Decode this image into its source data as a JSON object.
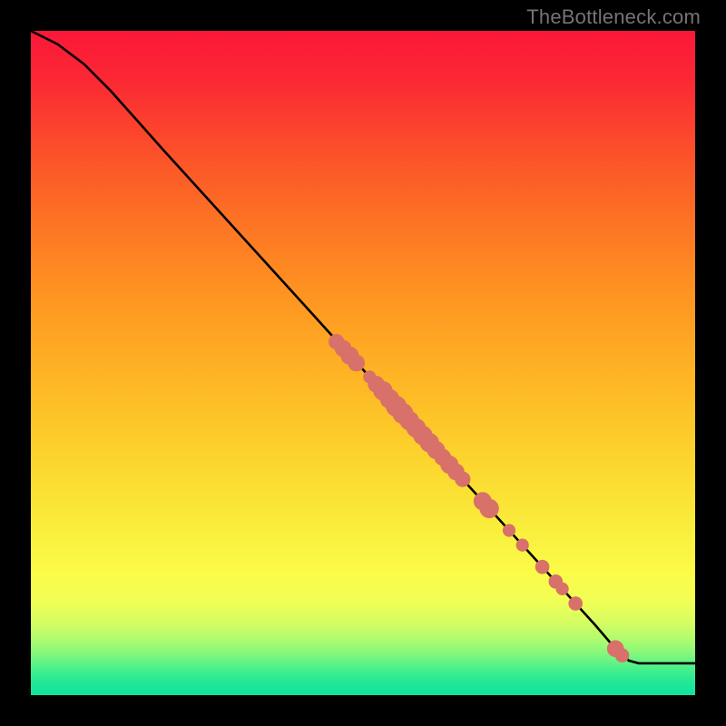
{
  "watermark": "TheBottleneck.com",
  "colors": {
    "background": "#000000",
    "curve": "#000000",
    "marker": "#d87169",
    "watermark": "#747474"
  },
  "chart_data": {
    "type": "line",
    "title": "",
    "xlabel": "",
    "ylabel": "",
    "xlim": [
      0,
      100
    ],
    "ylim": [
      0,
      100
    ],
    "curve": [
      {
        "x": 0,
        "y": 100
      },
      {
        "x": 4,
        "y": 98
      },
      {
        "x": 8,
        "y": 95
      },
      {
        "x": 12,
        "y": 91
      },
      {
        "x": 16,
        "y": 86.5
      },
      {
        "x": 20,
        "y": 82
      },
      {
        "x": 25,
        "y": 76.5
      },
      {
        "x": 30,
        "y": 71
      },
      {
        "x": 35,
        "y": 65.5
      },
      {
        "x": 40,
        "y": 60
      },
      {
        "x": 45,
        "y": 54.5
      },
      {
        "x": 50,
        "y": 49
      },
      {
        "x": 55,
        "y": 43.5
      },
      {
        "x": 60,
        "y": 38
      },
      {
        "x": 65,
        "y": 32.5
      },
      {
        "x": 70,
        "y": 27
      },
      {
        "x": 75,
        "y": 21.5
      },
      {
        "x": 80,
        "y": 16
      },
      {
        "x": 85,
        "y": 10.5
      },
      {
        "x": 88,
        "y": 7
      },
      {
        "x": 90,
        "y": 5.2
      },
      {
        "x": 91.5,
        "y": 4.8
      },
      {
        "x": 100,
        "y": 4.8
      }
    ],
    "markers": [
      {
        "x": 46,
        "y": 53.2,
        "r": 2.2
      },
      {
        "x": 47,
        "y": 52.2,
        "r": 2.4
      },
      {
        "x": 48,
        "y": 51.1,
        "r": 2.6
      },
      {
        "x": 49,
        "y": 50.0,
        "r": 2.4
      },
      {
        "x": 51,
        "y": 47.9,
        "r": 1.8
      },
      {
        "x": 52,
        "y": 46.8,
        "r": 2.4
      },
      {
        "x": 53,
        "y": 45.8,
        "r": 2.8
      },
      {
        "x": 54,
        "y": 44.6,
        "r": 2.8
      },
      {
        "x": 55,
        "y": 43.5,
        "r": 3.0
      },
      {
        "x": 56,
        "y": 42.4,
        "r": 3.0
      },
      {
        "x": 57,
        "y": 41.3,
        "r": 2.8
      },
      {
        "x": 58,
        "y": 40.2,
        "r": 2.8
      },
      {
        "x": 59,
        "y": 39.1,
        "r": 2.8
      },
      {
        "x": 60,
        "y": 38.0,
        "r": 2.8
      },
      {
        "x": 61,
        "y": 36.9,
        "r": 2.6
      },
      {
        "x": 62,
        "y": 35.8,
        "r": 2.4
      },
      {
        "x": 63,
        "y": 34.7,
        "r": 2.6
      },
      {
        "x": 64,
        "y": 33.6,
        "r": 2.4
      },
      {
        "x": 65,
        "y": 32.5,
        "r": 2.2
      },
      {
        "x": 68,
        "y": 29.2,
        "r": 2.6
      },
      {
        "x": 69,
        "y": 28.1,
        "r": 2.8
      },
      {
        "x": 72,
        "y": 24.8,
        "r": 1.8
      },
      {
        "x": 74,
        "y": 22.6,
        "r": 1.8
      },
      {
        "x": 77,
        "y": 19.3,
        "r": 2.0
      },
      {
        "x": 79,
        "y": 17.1,
        "r": 2.0
      },
      {
        "x": 80,
        "y": 16.0,
        "r": 1.8
      },
      {
        "x": 82,
        "y": 13.8,
        "r": 2.0
      },
      {
        "x": 88,
        "y": 7.0,
        "r": 2.4
      },
      {
        "x": 89,
        "y": 6.0,
        "r": 2.0
      }
    ]
  }
}
